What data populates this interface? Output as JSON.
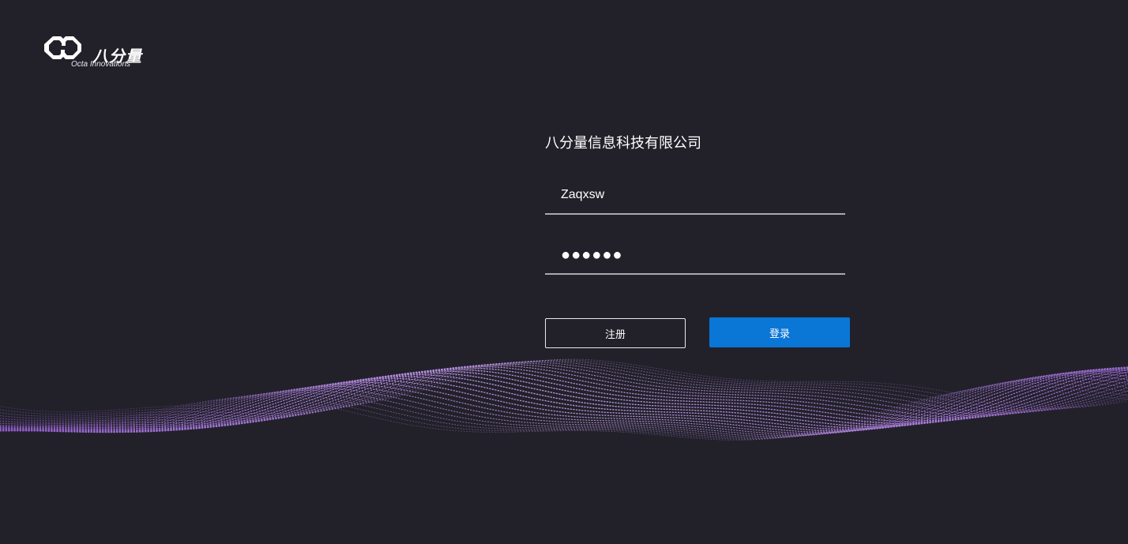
{
  "logo": {
    "name_cn": "八分量",
    "name_en": "Octa Innovations",
    "icon": "chain-link-logo-icon"
  },
  "login": {
    "company_title": "八分量信息科技有限公司",
    "username_value": "Zaqxsw",
    "password_value": "●●●●●●",
    "register_label": "注册",
    "login_label": "登录"
  },
  "colors": {
    "background": "#22212a",
    "primary_button": "#0a76d6",
    "wave_accent": "#a97bd9"
  }
}
